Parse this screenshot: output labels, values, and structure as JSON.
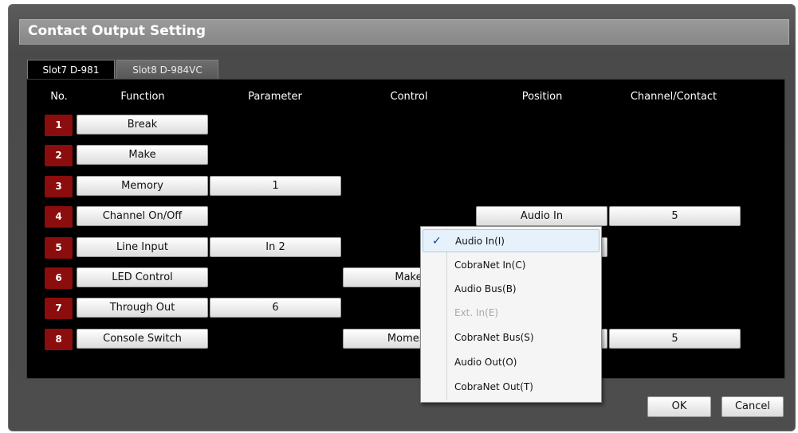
{
  "dialog": {
    "title": "Contact Output Setting"
  },
  "tabs": [
    {
      "label": "Slot7  D-981",
      "active": true
    },
    {
      "label": "Slot8  D-984VC",
      "active": false
    }
  ],
  "headers": {
    "no": "No.",
    "function": "Function",
    "parameter": "Parameter",
    "control": "Control",
    "position": "Position",
    "channel": "Channel/Contact"
  },
  "rows": [
    {
      "no": "1",
      "function": "Break",
      "parameter": "",
      "control": "",
      "position": "",
      "channel": ""
    },
    {
      "no": "2",
      "function": "Make",
      "parameter": "",
      "control": "",
      "position": "",
      "channel": ""
    },
    {
      "no": "3",
      "function": "Memory",
      "parameter": "1",
      "control": "",
      "position": "",
      "channel": ""
    },
    {
      "no": "4",
      "function": "Channel On/Off",
      "parameter": "",
      "control": "",
      "position": "Audio In",
      "channel": "5"
    },
    {
      "no": "5",
      "function": "Line Input",
      "parameter": "In 2",
      "control": "",
      "position": "",
      "channel": ""
    },
    {
      "no": "6",
      "function": "LED Control",
      "parameter": "",
      "control": "Make",
      "position": "",
      "channel": ""
    },
    {
      "no": "7",
      "function": "Through Out",
      "parameter": "6",
      "control": "",
      "position": "",
      "channel": ""
    },
    {
      "no": "8",
      "function": "Console Switch",
      "parameter": "",
      "control": "Moment",
      "position": "",
      "channel": "5"
    }
  ],
  "menu": {
    "items": [
      {
        "label": "Audio In(I)",
        "checked": true,
        "disabled": false
      },
      {
        "label": "CobraNet In(C)",
        "checked": false,
        "disabled": false
      },
      {
        "label": "Audio Bus(B)",
        "checked": false,
        "disabled": false
      },
      {
        "label": "Ext. In(E)",
        "checked": false,
        "disabled": true
      },
      {
        "label": "CobraNet Bus(S)",
        "checked": false,
        "disabled": false
      },
      {
        "label": "Audio Out(O)",
        "checked": false,
        "disabled": false
      },
      {
        "label": "CobraNet Out(T)",
        "checked": false,
        "disabled": false
      }
    ],
    "check_glyph": "✓"
  },
  "buttons": {
    "ok": "OK",
    "cancel": "Cancel"
  },
  "colors": {
    "number_badge": "#8b0d0d",
    "panel": "#000000",
    "title_bar": "#8f8f8f"
  }
}
